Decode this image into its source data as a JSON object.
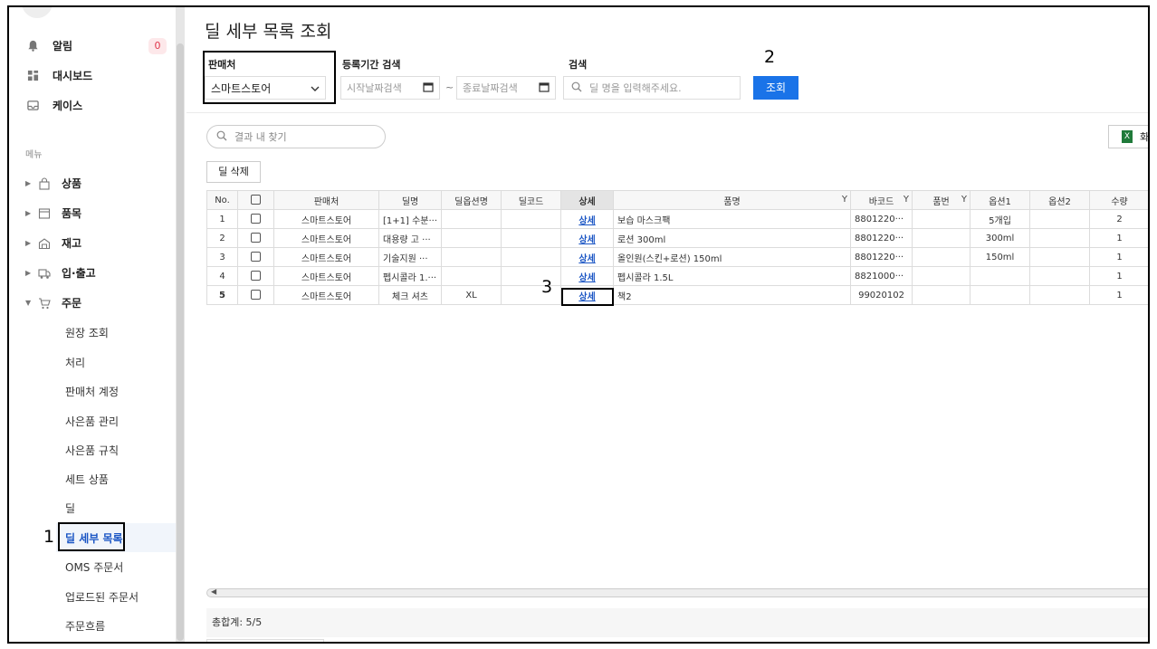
{
  "sidebar": {
    "top": [
      {
        "icon": "bell-icon",
        "label": "알림"
      },
      {
        "icon": "dashboard-icon",
        "label": "대시보드"
      },
      {
        "icon": "inbox-icon",
        "label": "케이스"
      }
    ],
    "alert_count": "0",
    "menu_title": "메뉴",
    "tree": [
      {
        "icon": "bag-icon",
        "label": "상품"
      },
      {
        "icon": "calendar-box-icon",
        "label": "품목"
      },
      {
        "icon": "warehouse-icon",
        "label": "재고"
      },
      {
        "icon": "truck-icon",
        "label": "입·출고"
      },
      {
        "icon": "cart-icon",
        "label": "주문"
      }
    ],
    "sub": [
      "원장 조회",
      "처리",
      "판매처 계정",
      "사은품 관리",
      "사은품 규칙",
      "세트 상품",
      "딜",
      "딜 세부 목록",
      "OMS 주문서",
      "업로드된 주문서",
      "주문흐름"
    ]
  },
  "markers": {
    "m1": "1",
    "m2": "2",
    "m3": "3"
  },
  "page": {
    "title": "딜 세부 목록 조회",
    "seller_label": "판매처",
    "seller_value": "스마트스토어",
    "period_label": "등록기간 검색",
    "start_placeholder": "시작날짜검색",
    "tilde": "~",
    "end_placeholder": "종료날짜검색",
    "search_label": "검색",
    "search_placeholder": "딜 명을 입력해주세요.",
    "search_button": "조회",
    "filter_placeholder": "결과 내 찾기",
    "excel_label": "화",
    "delete_button": "딜 삭제",
    "total": "총합계: 5/5"
  },
  "table": {
    "headers": [
      "No.",
      "",
      "판매처",
      "딜명",
      "딜옵션명",
      "딜코드",
      "상세",
      "품명",
      "바코드",
      "품번",
      "옵션1",
      "옵션2",
      "수량"
    ],
    "rows": [
      [
        "1",
        "",
        "스마트스토어",
        "[1+1] 수분···",
        "",
        "",
        "상세",
        "보습 마스크팩",
        "8801220···",
        "",
        "5개입",
        "",
        "2"
      ],
      [
        "2",
        "",
        "스마트스토어",
        "대용량 고 ···",
        "",
        "",
        "상세",
        "로션 300ml",
        "8801220···",
        "",
        "300ml",
        "",
        "1"
      ],
      [
        "3",
        "",
        "스마트스토어",
        "기술지원 ···",
        "",
        "",
        "상세",
        "올인원(스킨+로션) 150ml",
        "8801220···",
        "",
        "150ml",
        "",
        "1"
      ],
      [
        "4",
        "",
        "스마트스토어",
        "펩시콜라 1.···",
        "",
        "",
        "상세",
        "펩시콜라 1.5L",
        "8821000···",
        "",
        "",
        "",
        "1"
      ],
      [
        "5",
        "",
        "스마트스토어",
        "체크 셔츠",
        "XL",
        "",
        "상세",
        "책2",
        "99020102",
        "",
        "",
        "",
        "1"
      ]
    ]
  }
}
